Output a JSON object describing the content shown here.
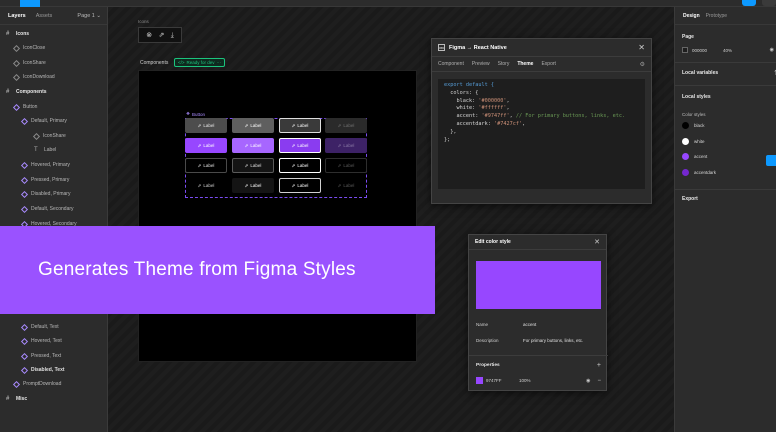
{
  "left_panel": {
    "tabs": [
      "Layers",
      "Assets"
    ],
    "pages_label": "Page 1 ⌄",
    "layers": [
      {
        "label": "Icons",
        "kind": "section"
      },
      {
        "label": "IconClose",
        "kind": "icon"
      },
      {
        "label": "IconShare",
        "kind": "icon"
      },
      {
        "label": "IconDownload",
        "kind": "icon"
      },
      {
        "label": "Components",
        "kind": "section"
      },
      {
        "label": "Button",
        "kind": "comp"
      },
      {
        "label": "Default, Primary",
        "kind": "comp"
      },
      {
        "label": "IconShare",
        "kind": "icon"
      },
      {
        "label": "Label",
        "kind": "text"
      },
      {
        "label": "Hovered, Primary",
        "kind": "comp"
      },
      {
        "label": "Pressed, Primary",
        "kind": "comp"
      },
      {
        "label": "Disabled, Primary",
        "kind": "comp"
      },
      {
        "label": "Default, Secondary",
        "kind": "comp"
      },
      {
        "label": "Hovered, Secondary",
        "kind": "comp"
      },
      {
        "label": "Default, Text",
        "kind": "comp"
      },
      {
        "label": "Hovered, Text",
        "kind": "comp"
      },
      {
        "label": "Pressed, Text",
        "kind": "comp"
      },
      {
        "label": "Disabled, Text",
        "kind": "comp"
      },
      {
        "label": "PromptDownload",
        "kind": "comp"
      },
      {
        "label": "Misc",
        "kind": "section"
      }
    ]
  },
  "canvas": {
    "icons_frame_label": "Icons",
    "icons": [
      "⊗",
      "⇗",
      "⤓"
    ],
    "components_label": "Components",
    "ready_badge": "Ready for dev",
    "button_set_label": "Button",
    "variant_label": "Label",
    "variant_icon": "⇗"
  },
  "plugin": {
    "title": "Figma → React Native",
    "tabs": [
      "Component",
      "Preview",
      "Story",
      "Theme",
      "Export"
    ],
    "active_tab": "Theme",
    "code": {
      "l1": "export default {",
      "l2": "  colors: {",
      "l3_key": "    black: ",
      "l3_val": "'#000000'",
      "l4_key": "    white: ",
      "l4_val": "'#ffffff'",
      "l5_key": "    accent: ",
      "l5_val": "'#9747ff'",
      "l5_comment": " // For primary buttons, links, etc.",
      "l6_key": "    accentdark: ",
      "l6_val": "'#7427cf'",
      "l7": "  },",
      "l8": "};"
    }
  },
  "edit_style": {
    "title": "Edit color style",
    "name_label": "Name",
    "name_value": "accent",
    "description_label": "Description",
    "description_value": "For primary buttons, links, etc.",
    "properties_label": "Properties",
    "hex": "9747FF",
    "opacity": "100%",
    "color": "#9747ff"
  },
  "banner": {
    "text": "Generates Theme from Figma Styles"
  },
  "right_panel": {
    "tabs": [
      "Design",
      "Prototype"
    ],
    "page_label": "Page",
    "page_color": "000000",
    "page_opacity": "40%",
    "local_variables": "Local variables",
    "local_styles": "Local styles",
    "color_styles": "Color styles",
    "styles": [
      {
        "name": "black",
        "color": "#000000"
      },
      {
        "name": "white",
        "color": "#ffffff"
      },
      {
        "name": "accent",
        "color": "#9747ff"
      },
      {
        "name": "accentdark",
        "color": "#7427cf"
      }
    ],
    "export": "Export"
  },
  "colors": {
    "accent": "#9747ff",
    "figma_blue": "#0d99ff",
    "ready_green": "#1bc47d"
  }
}
